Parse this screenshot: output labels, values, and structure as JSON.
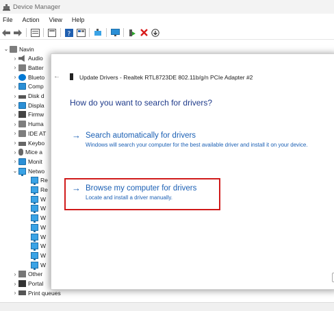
{
  "window": {
    "title": "Device Manager"
  },
  "menu": [
    "File",
    "Action",
    "View",
    "Help"
  ],
  "toolbar": {
    "icons": [
      "back-arrow-icon",
      "forward-arrow-icon",
      "properties-icon",
      "show-hidden-icon",
      "help-icon",
      "view-icon",
      "scan-hardware-icon",
      "monitor-icon",
      "enable-device-icon",
      "uninstall-icon",
      "update-driver-icon"
    ]
  },
  "tree": {
    "root": "Navin",
    "items": [
      {
        "label": "Audio",
        "icon": "audio-icon",
        "expanded": false
      },
      {
        "label": "Batter",
        "icon": "battery-icon",
        "expanded": false
      },
      {
        "label": "Blueto",
        "icon": "bluetooth-icon",
        "expanded": false
      },
      {
        "label": "Comp",
        "icon": "computer-icon",
        "expanded": false
      },
      {
        "label": "Disk d",
        "icon": "disk-icon",
        "expanded": false
      },
      {
        "label": "Displa",
        "icon": "display-icon",
        "expanded": false
      },
      {
        "label": "Firmw",
        "icon": "firmware-icon",
        "expanded": false
      },
      {
        "label": "Huma",
        "icon": "hid-icon",
        "expanded": false
      },
      {
        "label": "IDE AT",
        "icon": "ide-icon",
        "expanded": false
      },
      {
        "label": "Keybo",
        "icon": "keyboard-icon",
        "expanded": false
      },
      {
        "label": "Mice a",
        "icon": "mouse-icon",
        "expanded": false
      },
      {
        "label": "Monit",
        "icon": "monitor-icon",
        "expanded": false
      },
      {
        "label": "Netwo",
        "icon": "network-icon",
        "expanded": true
      }
    ],
    "network_children": [
      "Re",
      "Re",
      "W",
      "W",
      "W",
      "W",
      "W",
      "W",
      "W",
      "W"
    ],
    "after_items": [
      {
        "label": "Other",
        "icon": "other-devices-icon"
      },
      {
        "label": "Portal",
        "icon": "portable-devices-icon"
      },
      {
        "label": "Print queues",
        "icon": "printer-icon"
      }
    ]
  },
  "dialog": {
    "title": "Update Drivers - Realtek RTL8723DE 802.11b/g/n PCIe Adapter #2",
    "question": "How do you want to search for drivers?",
    "option1": {
      "title": "Search automatically for drivers",
      "description": "Windows will search your computer for the best available driver and install it on your device."
    },
    "option2": {
      "title": "Browse my computer for drivers",
      "description": "Locate and install a driver manually."
    },
    "highlight_color": "#d01a1a",
    "link_color": "#1a5fb4"
  }
}
